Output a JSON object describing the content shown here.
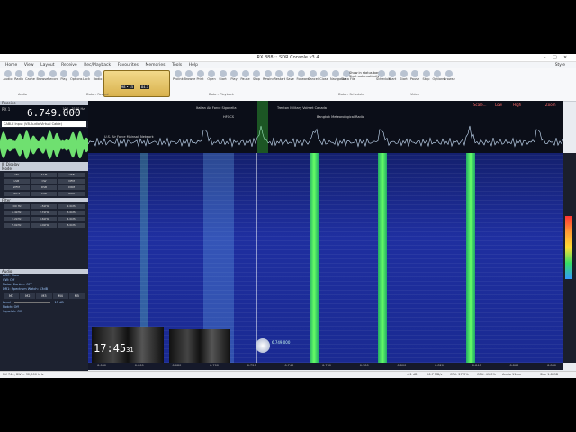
{
  "window": {
    "title": "RX 888 :: SDR Console v3.4",
    "controls": [
      "–",
      "□",
      "✕"
    ],
    "style_label": "Style"
  },
  "menu": [
    "Home",
    "View",
    "Layout",
    "Receive",
    "Rec/Playback",
    "Favourites",
    "Memories",
    "Tools",
    "Help"
  ],
  "ribbon": {
    "buttons": [
      "Audio",
      "Radio",
      "Cache",
      "Browse",
      "Record",
      "Play",
      "Options",
      "Lock",
      "Radio",
      "Prolink",
      "Browse",
      "Print",
      "Open",
      "Start",
      "Play",
      "Pause",
      "Stop",
      "Rewind",
      "Restart",
      "Save",
      "Forward",
      "Cancel",
      "Close",
      "Navigator",
      "Data File",
      "Schedule",
      "Start",
      "Start",
      "Pause",
      "Stop",
      "Options",
      "Browse"
    ],
    "groups": [
      "Audio",
      "Data – Record",
      "Data – Playback",
      "Data – Scheduler",
      "Video"
    ],
    "dial_readouts": [
      "98 • 15",
      "84.7"
    ],
    "schedule_opts": [
      "Show in status bar",
      "Start automatically"
    ]
  },
  "left": {
    "receive_header": "Receive",
    "rx_label": "RX 1",
    "frequency": "6.749.000",
    "range": "100 - 3100 Hz",
    "audio_device": "CABLE Input (VB-Audio Virtual Cable)",
    "display_header": "IF Display",
    "modes_header": "Mode",
    "mode_buttons": [
      "AM",
      "SAM",
      "USB",
      "LSB",
      "CW",
      "NFM",
      "WFM",
      "DSB",
      "DRM",
      "AM-S",
      "LSB",
      "Auto"
    ],
    "filter_header": "Filter",
    "filter_buttons": [
      "100 Hz",
      "1.5kHz",
      "2.0kHz",
      "2.4kHz",
      "2.7kHz",
      "3.0kHz",
      "3.2kHz",
      "3.6kHz",
      "4.0kHz",
      "5.0kHz",
      "6.0kHz",
      "8.0kHz"
    ],
    "audio_header": "Audio",
    "audio_lines": [
      "AGC: Slow",
      "CW: Off",
      "Noise Blanker: OFF",
      "DR1: Spectrum Watch: 13dB"
    ],
    "memory_buttons": [
      "M1",
      "M2",
      "M3",
      "M4",
      "M5"
    ],
    "level_label": "Level",
    "level_value": "15 dB",
    "notch": "Notch: Off",
    "squelch": "Squelch: Off"
  },
  "spectrum": {
    "controls": [
      "Scale...",
      "Low",
      "High",
      "Zoom"
    ],
    "annotations": [
      "Italian Air Force Sigonella",
      "HFGCS",
      "Trenton Military Volmet Canada",
      "Bangkok Meteorological Radio",
      "U.S. Air Force Mainsail Network"
    ]
  },
  "waterfall": {
    "clock": "17:45",
    "clock_seconds": "31",
    "cursor_freq": "6.749.000"
  },
  "scale_ticks": [
    "6.640",
    "6.660",
    "6.680",
    "6.700",
    "6.720",
    "6.740",
    "6.760",
    "6.780",
    "6.800",
    "6.820",
    "6.840",
    "6.860",
    "6.880"
  ],
  "status": {
    "left": "RX 744, BW = 32,000 kHz",
    "right_items": [
      "-61 dB",
      "96.7 MB/s",
      "CPU: 27.3%",
      "GPU: 41.0%",
      "Audio 11ms",
      "Size 1.8 GB"
    ]
  }
}
